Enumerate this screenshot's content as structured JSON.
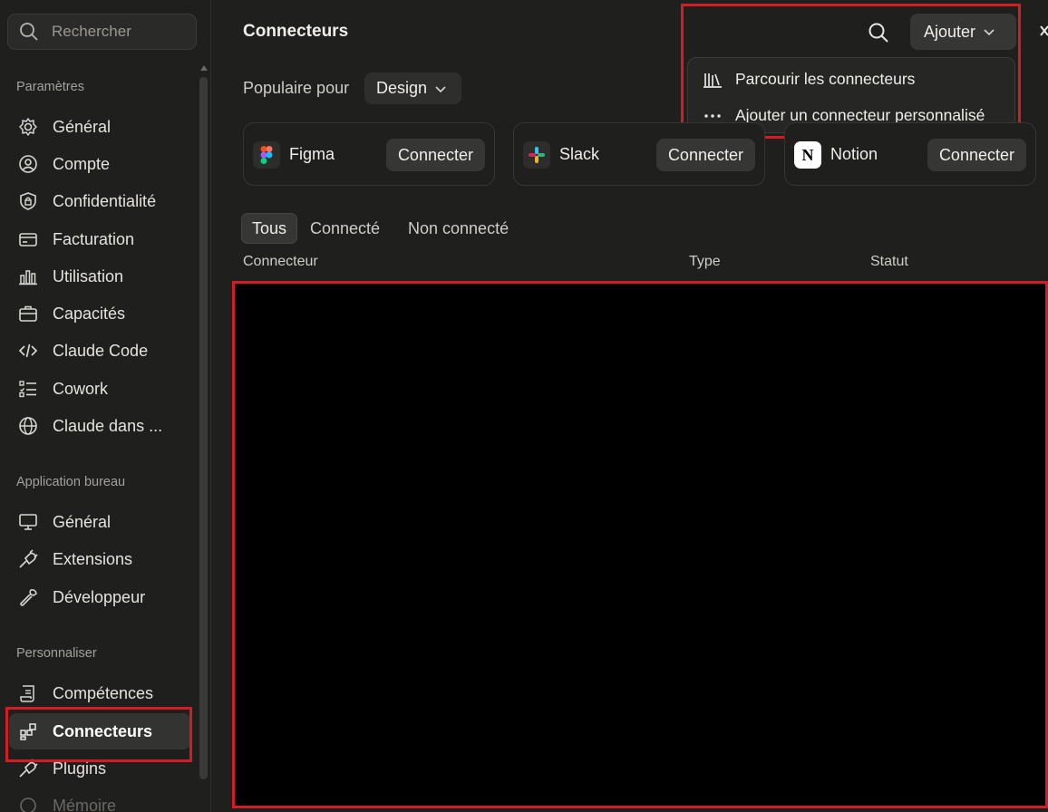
{
  "sidebar": {
    "search_placeholder": "Rechercher",
    "sections": {
      "settings": "Paramètres",
      "desktop": "Application bureau",
      "personalize": "Personnaliser"
    },
    "settings_items": [
      "Général",
      "Compte",
      "Confidentialité",
      "Facturation",
      "Utilisation",
      "Capacités",
      "Claude Code",
      "Cowork",
      "Claude dans ..."
    ],
    "desktop_items": [
      "Général",
      "Extensions",
      "Développeur"
    ],
    "personalize_items": [
      "Compétences",
      "Connecteurs",
      "Plugins",
      "Mémoire"
    ],
    "active_item": "Connecteurs"
  },
  "header": {
    "title": "Connecteurs",
    "add_label": "Ajouter"
  },
  "add_menu": {
    "items": [
      "Parcourir les connecteurs",
      "Ajouter un connecteur personnalisé"
    ]
  },
  "popular": {
    "label": "Populaire pour",
    "filter": "Design",
    "cards": [
      {
        "name": "Figma",
        "action": "Connecter"
      },
      {
        "name": "Slack",
        "action": "Connecter"
      },
      {
        "name": "Notion",
        "action": "Connecter"
      }
    ]
  },
  "tabs": [
    "Tous",
    "Connecté",
    "Non connecté"
  ],
  "table": {
    "columns": [
      "Connecteur",
      "Type",
      "Statut"
    ]
  },
  "colors": {
    "background": "#1f1f1e",
    "highlight_outline": "#d31d26"
  }
}
